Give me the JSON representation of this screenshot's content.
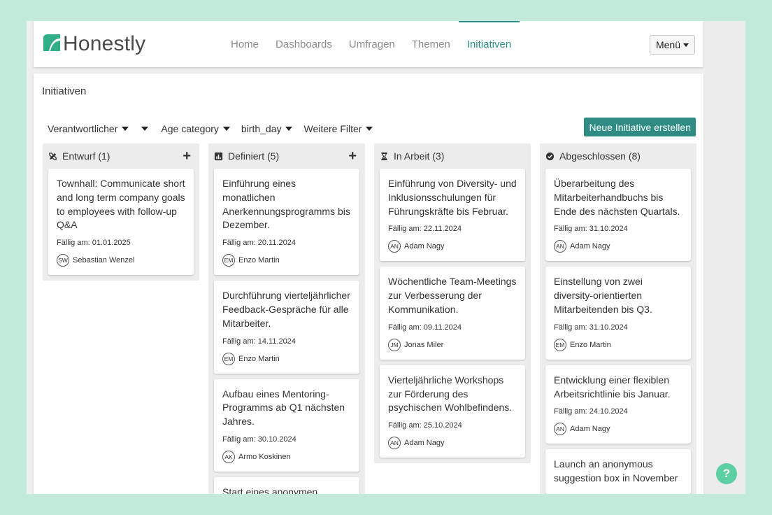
{
  "brand": {
    "name": "Honestly",
    "color": "#2b8f85"
  },
  "nav": {
    "items": [
      {
        "label": "Home",
        "active": false
      },
      {
        "label": "Dashboards",
        "active": false
      },
      {
        "label": "Umfragen",
        "active": false
      },
      {
        "label": "Themen",
        "active": false
      },
      {
        "label": "Initiativen",
        "active": true
      }
    ],
    "menu_label": "Menü"
  },
  "page": {
    "title": "Initiativen"
  },
  "filters": {
    "owner": "Verantwortlicher",
    "age": "Age category",
    "birthday": "birth_day",
    "more": "Weitere Filter"
  },
  "actions": {
    "new_initiative": "Neue Initiative erstellen"
  },
  "help_label": "?",
  "columns": [
    {
      "title": "Entwurf (1)",
      "icon": "pencil-ruler-icon",
      "has_add": true,
      "cards": [
        {
          "title": "Townhall: Communicate short and long term company goals to employees with follow-up Q&A",
          "due": "Fällig am: 01.01.2025",
          "initials": "SW",
          "owner": "Sebastian Wenzel"
        }
      ]
    },
    {
      "title": "Definiert (5)",
      "icon": "chart-icon",
      "has_add": true,
      "cards": [
        {
          "title": "Einführung eines monatlichen Anerkennungsprogramms bis Dezember.",
          "due": "Fällig am: 20.11.2024",
          "initials": "EM",
          "owner": "Enzo Martin"
        },
        {
          "title": "Durchführung vierteljährlicher Feedback-Gespräche für alle Mitarbeiter.",
          "due": "Fällig am: 14.11.2024",
          "initials": "EM",
          "owner": "Enzo Martin"
        },
        {
          "title": "Aufbau eines Mentoring-Programms ab Q1 nächsten Jahres.",
          "due": "Fällig am: 30.10.2024",
          "initials": "AK",
          "owner": "Armo Koskinen"
        },
        {
          "title": "Start eines anonymen",
          "due": "",
          "initials": "",
          "owner": ""
        }
      ]
    },
    {
      "title": "In Arbeit (3)",
      "icon": "hourglass-icon",
      "has_add": false,
      "cards": [
        {
          "title": "Einführung von Diversity- und Inklusionsschulungen für Führungskräfte bis Februar.",
          "due": "Fällig am: 22.11.2024",
          "initials": "AN",
          "owner": "Adam Nagy"
        },
        {
          "title": "Wöchentliche Team-Meetings zur Verbesserung der Kommunikation.",
          "due": "Fällig am: 09.11.2024",
          "initials": "JM",
          "owner": "Jonas Miler"
        },
        {
          "title": "Vierteljährliche Workshops zur Förderung des psychischen Wohlbefindens.",
          "due": "Fällig am: 25.10.2024",
          "initials": "AN",
          "owner": "Adam Nagy"
        }
      ]
    },
    {
      "title": "Abgeschlossen (8)",
      "icon": "check-circle-icon",
      "has_add": false,
      "cards": [
        {
          "title": "Überarbeitung des Mitarbeiterhandbuchs bis Ende des nächsten Quartals.",
          "due": "Fällig am: 31.10.2024",
          "initials": "AN",
          "owner": "Adam Nagy"
        },
        {
          "title": "Einstellung von zwei diversity-orientierten Mitarbeitenden bis Q3.",
          "due": "Fällig am: 31.10.2024",
          "initials": "EM",
          "owner": "Enzo Martin"
        },
        {
          "title": "Entwicklung einer flexiblen Arbeitsrichtlinie bis Januar.",
          "due": "Fällig am: 24.10.2024",
          "initials": "AN",
          "owner": "Adam Nagy"
        },
        {
          "title": "Launch an anonymous suggestion box in November",
          "due": "",
          "initials": "",
          "owner": ""
        }
      ]
    }
  ]
}
